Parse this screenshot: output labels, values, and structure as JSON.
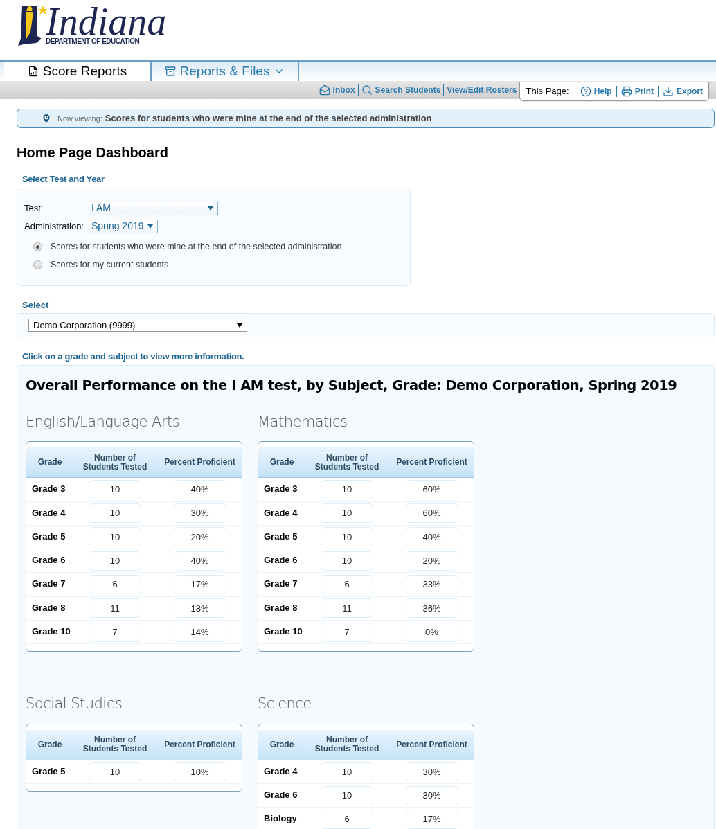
{
  "logo": {
    "title": "Indiana",
    "subtitle": "DEPARTMENT OF EDUCATION"
  },
  "tabs": [
    {
      "label": "Score Reports",
      "selected": true,
      "kind": "report"
    },
    {
      "label": "Reports & Files",
      "selected": false,
      "kind": "files"
    }
  ],
  "toolbar": {
    "links": [
      {
        "label": "Inbox",
        "kind": "inbox"
      },
      {
        "label": "Search Students",
        "kind": "search"
      },
      {
        "label": "View/Edit Rosters",
        "kind": "none"
      }
    ],
    "page_label": "This Page:",
    "page_links": [
      {
        "label": "Help",
        "kind": "help"
      },
      {
        "label": "Print",
        "kind": "print"
      },
      {
        "label": "Export",
        "kind": "export"
      }
    ]
  },
  "banner": {
    "prefix": "Now viewing:",
    "text": "Scores for students who were mine at the end of the selected administration"
  },
  "heading": "Home Page Dashboard",
  "test_section": {
    "title": "Select Test and Year",
    "test_label": "Test:",
    "test_value": "I AM",
    "admin_label": "Administration:",
    "admin_value": "Spring 2019",
    "options": [
      {
        "label": "Scores for students who were mine at the end of the selected administration",
        "selected": true
      },
      {
        "label": "Scores for my current students",
        "selected": false
      }
    ]
  },
  "select_section": {
    "title": "Select",
    "value": "Demo Corporation (9999)"
  },
  "hint": "Click on a grade and subject to view more information.",
  "panel_title": "Overall Performance on the I AM test, by Subject, Grade: Demo Corporation, Spring 2019",
  "subjects": [
    {
      "name": "English/Language Arts",
      "columns": [
        "Grade",
        "Number of Students Tested",
        "Percent Proficient"
      ],
      "rows": [
        [
          "Grade 3",
          "10",
          "40%"
        ],
        [
          "Grade 4",
          "10",
          "30%"
        ],
        [
          "Grade 5",
          "10",
          "20%"
        ],
        [
          "Grade 6",
          "10",
          "40%"
        ],
        [
          "Grade 7",
          "6",
          "17%"
        ],
        [
          "Grade 8",
          "11",
          "18%"
        ],
        [
          "Grade 10",
          "7",
          "14%"
        ]
      ]
    },
    {
      "name": "Mathematics",
      "columns": [
        "Grade",
        "Number of Students Tested",
        "Percent Proficient"
      ],
      "rows": [
        [
          "Grade 3",
          "10",
          "60%"
        ],
        [
          "Grade 4",
          "10",
          "60%"
        ],
        [
          "Grade 5",
          "10",
          "40%"
        ],
        [
          "Grade 6",
          "10",
          "20%"
        ],
        [
          "Grade 7",
          "6",
          "33%"
        ],
        [
          "Grade 8",
          "11",
          "36%"
        ],
        [
          "Grade 10",
          "7",
          "0%"
        ]
      ]
    },
    {
      "name": "Social Studies",
      "columns": [
        "Grade",
        "Number of Students Tested",
        "Percent Proficient"
      ],
      "rows": [
        [
          "Grade 5",
          "10",
          "10%"
        ]
      ]
    },
    {
      "name": "Science",
      "columns": [
        "Grade",
        "Number of Students Tested",
        "Percent Proficient"
      ],
      "rows": [
        [
          "Grade 4",
          "10",
          "30%"
        ],
        [
          "Grade 6",
          "10",
          "30%"
        ],
        [
          "Biology",
          "6",
          "17%"
        ]
      ]
    }
  ]
}
